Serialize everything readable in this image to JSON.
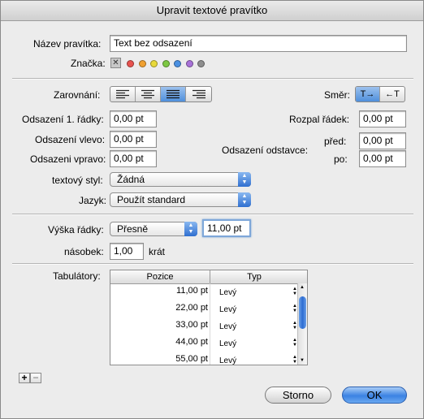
{
  "window": {
    "title": "Upravit textové pravítko"
  },
  "ruler_name": {
    "label": "Název  pravítka:",
    "value": "Text bez odsazení"
  },
  "tag": {
    "label": "Značka:",
    "clear_symbol": "✕",
    "colors": [
      "#e8534f",
      "#f0a030",
      "#e8d93a",
      "#7dc843",
      "#4a90e2",
      "#a872d8",
      "#8e8e8e"
    ]
  },
  "alignment": {
    "label": "Zarovnání:",
    "options": [
      "align-left",
      "align-center",
      "align-justify",
      "align-right"
    ],
    "selected_index": 2
  },
  "direction": {
    "label": "Směr:",
    "ltr_label": "T→",
    "rtl_label": "←T",
    "selected": "ltr"
  },
  "indents": {
    "first_line": {
      "label": "Odsazení 1. řádky:",
      "value": "0,00 pt"
    },
    "left": {
      "label": "Odsazení vlevo:",
      "value": "0,00 pt"
    },
    "right": {
      "label": "Odsazeni vpravo:",
      "value": "0,00 pt"
    }
  },
  "line_spacing": {
    "label": "Rozpal řádek:",
    "value": "0,00 pt"
  },
  "paragraph": {
    "label": "Odsazení odstavce:",
    "before_label": "před:",
    "before_value": "0,00 pt",
    "after_label": "po:",
    "after_value": "0,00 pt"
  },
  "text_style": {
    "label": "textový styl:",
    "value": "Žádná"
  },
  "language": {
    "label": "Jazyk:",
    "value": "Použít standard"
  },
  "line_height": {
    "label": "Výška řádky:",
    "mode": "Přesně",
    "value": "11,00 pt"
  },
  "multiple": {
    "label": "násobek:",
    "value": "1,00",
    "unit": "krát"
  },
  "tabs": {
    "label": "Tabulátory:",
    "columns": [
      "Pozice",
      "Typ"
    ],
    "rows": [
      {
        "position": "11,00 pt",
        "type": "Levý"
      },
      {
        "position": "22,00 pt",
        "type": "Levý"
      },
      {
        "position": "33,00 pt",
        "type": "Levý"
      },
      {
        "position": "44,00 pt",
        "type": "Levý"
      },
      {
        "position": "55,00 pt",
        "type": "Levý"
      }
    ],
    "add_label": "+",
    "remove_label": "−"
  },
  "buttons": {
    "cancel": "Storno",
    "ok": "OK"
  }
}
